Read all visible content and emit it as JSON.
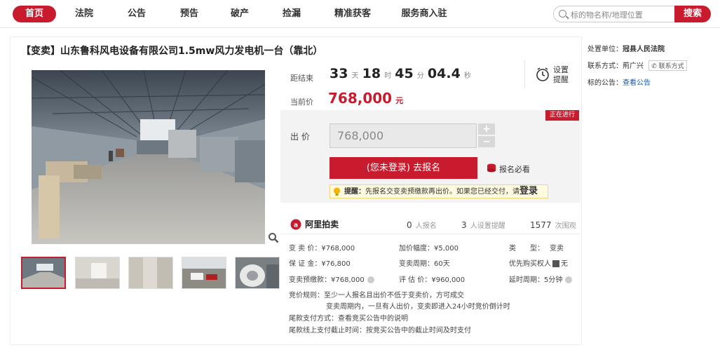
{
  "nav": {
    "items": [
      "首页",
      "法院",
      "公告",
      "预告",
      "破产",
      "捡漏",
      "精准获客",
      "服务商入驻"
    ],
    "search_placeholder": "标的物名称/地理位置",
    "search_button": "搜索"
  },
  "item": {
    "title": "【变卖】山东鲁科风电设备有限公司1.5mw风力发电机一台（靠北）"
  },
  "countdown": {
    "label": "距结束",
    "days": "33",
    "days_unit": "天",
    "hours": "18",
    "hours_unit": "时",
    "minutes": "45",
    "minutes_unit": "分",
    "seconds": "04.4",
    "seconds_unit": "秒",
    "reminder_label_1": "设置",
    "reminder_label_2": "提醒"
  },
  "price": {
    "current_label": "当前价",
    "current_value": "768,000",
    "currency_unit": "元"
  },
  "bid": {
    "status_badge": "正在进行",
    "bid_label": "出 价",
    "bid_value": "768,000",
    "plus": "+",
    "minus": "−",
    "register_button": "(您未登录) 去报名",
    "must_read": "报名必看",
    "tip_prefix": "提醒：",
    "tip_text": "先报名交变卖预缴款再出价。如果您已经交付，请",
    "tip_login": "登录"
  },
  "stats": {
    "brand": "阿里拍卖",
    "registered_count": "0",
    "registered_label": "人报名",
    "reminder_count": "3",
    "reminder_label": "人设置提醒",
    "views_count": "1577",
    "views_label": "次围观"
  },
  "details": {
    "sale_price_label": "变 卖 价：",
    "sale_price": "¥768,000",
    "increment_label": "加价幅度：",
    "increment": "¥5,000",
    "type_label": "类　　型：",
    "type": "变卖",
    "deposit_label": "保 证 金：",
    "deposit": "¥76,800",
    "period_label": "变卖周期：",
    "period": "60天",
    "priority_label": "优先购买权人",
    "priority_value": "无",
    "prepay_label": "变卖预缴款：",
    "prepay": "¥768,000",
    "appraisal_label": "评 估 价：",
    "appraisal": "¥960,000",
    "delay_label": "延时周期：",
    "delay": "5分钟",
    "rule_label": "竞价规则：",
    "rule_line1": "至少一人报名且出价不低于变卖价，方可成交",
    "rule_line2": "变卖周期内，一旦有人出价，变卖即进入24小时竞价倒计时",
    "final_payment_label": "尾款支付方式：",
    "final_payment": "查看竞买公告中的说明",
    "final_deadline_label": "尾款线上支付截止时间：",
    "final_deadline": "按竞买公告中的截止时间及时支付"
  },
  "sidebar": {
    "unit_label": "处置单位：",
    "unit_value": "冠县人民法院",
    "contact_label": "联系方式：",
    "contact_name": "荊广兴",
    "contact_button": "联系方式",
    "announcement_label": "标的公告：",
    "announcement_link": "查看公告"
  },
  "colors": {
    "accent": "#c81b2d",
    "link": "#1c5aa6"
  }
}
